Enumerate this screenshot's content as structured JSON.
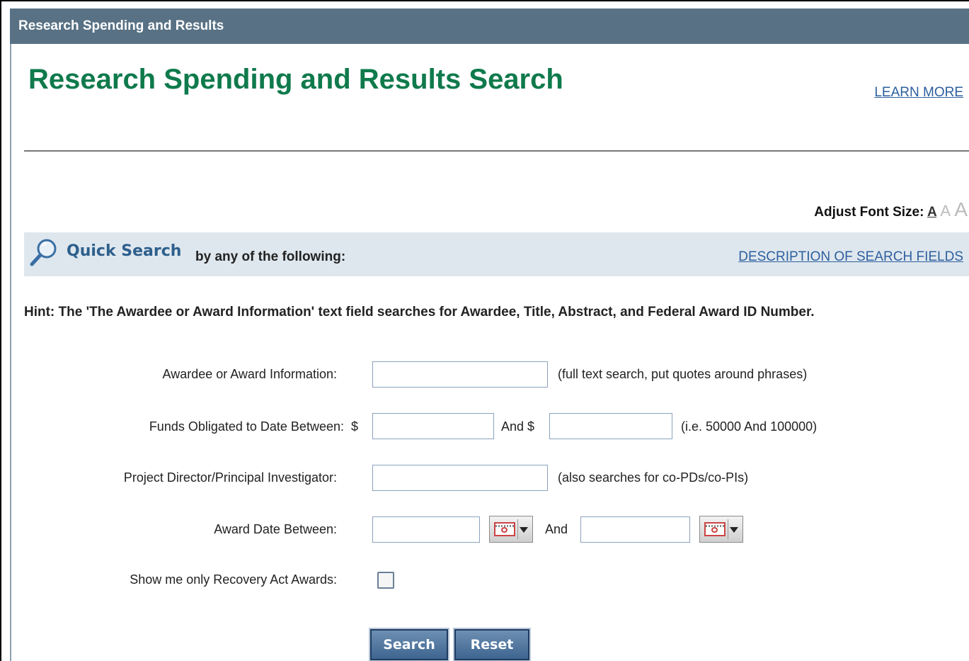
{
  "header": {
    "bar_title": "Research Spending and Results"
  },
  "page": {
    "title": "Research Spending and Results Search",
    "learn_more": "LEARN MORE",
    "font_size_label": "Adjust Font Size:",
    "font_size_options": [
      "A",
      "A",
      "A"
    ]
  },
  "quick_search": {
    "icon": "magnifier-icon",
    "title": "Quick Search",
    "subtitle": "by any of the following:",
    "description_link": "DESCRIPTION OF SEARCH FIELDS"
  },
  "hint": "Hint: The 'The Awardee or Award Information' text field searches for Awardee, Title, Abstract, and Federal Award ID Number.",
  "form": {
    "awardee_label": "Awardee or Award Information:",
    "awardee_value": "",
    "awardee_note": "(full text search, put quotes around phrases)",
    "funds_label": "Funds Obligated to Date Between:  $",
    "funds_min_value": "",
    "funds_and": "And $",
    "funds_max_value": "",
    "funds_note": "(i.e. 50000 And 100000)",
    "pi_label": "Project Director/Principal Investigator:",
    "pi_value": "",
    "pi_note": "(also searches for co-PDs/co-PIs)",
    "date_label": "Award Date Between:",
    "date_start_value": "",
    "date_and": "And",
    "date_end_value": "",
    "recovery_label": "Show me only Recovery Act Awards:",
    "recovery_checked": false
  },
  "buttons": {
    "search": "Search",
    "reset": "Reset"
  },
  "colors": {
    "header_bar": "#587184",
    "title_green": "#0f7a4c",
    "link_blue": "#2d5f9e",
    "panel": "#dfe7ee"
  }
}
